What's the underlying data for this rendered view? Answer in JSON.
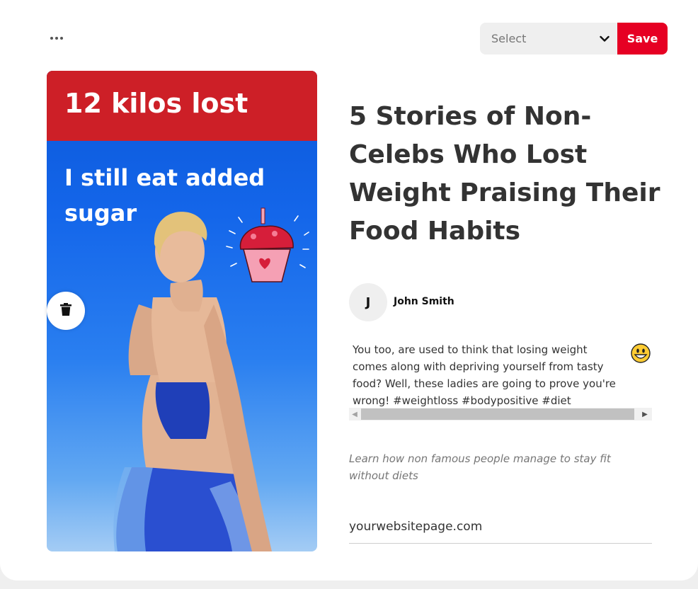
{
  "toolbar": {
    "more_icon": "ellipsis-horizontal-icon",
    "board_select": {
      "selected": "Select",
      "icon": "chevron-down-icon"
    },
    "save_label": "Save",
    "save_color": "#e60023"
  },
  "pin": {
    "banner_text": "12 kilos lost",
    "subtitle": "I still eat added sugar",
    "banner_color": "#cd1f27",
    "background_color": "#0b57d8",
    "delete_icon": "trash-icon"
  },
  "details": {
    "title": "5 Stories of Non-Celebs Who Lost Weight Praising Their Food Habits",
    "author": {
      "initial": "J",
      "name": "John Smith"
    },
    "description": "You too, are used to think that losing weight comes along with depriving yourself from tasty food? Well, these ladies are going to prove you're wrong! #weightloss #bodypositive #diet",
    "description_emoji": "grinning-face-emoji",
    "alt_text": "Learn how non famous people manage to stay fit without diets",
    "link": "yourwebsitepage.com"
  }
}
